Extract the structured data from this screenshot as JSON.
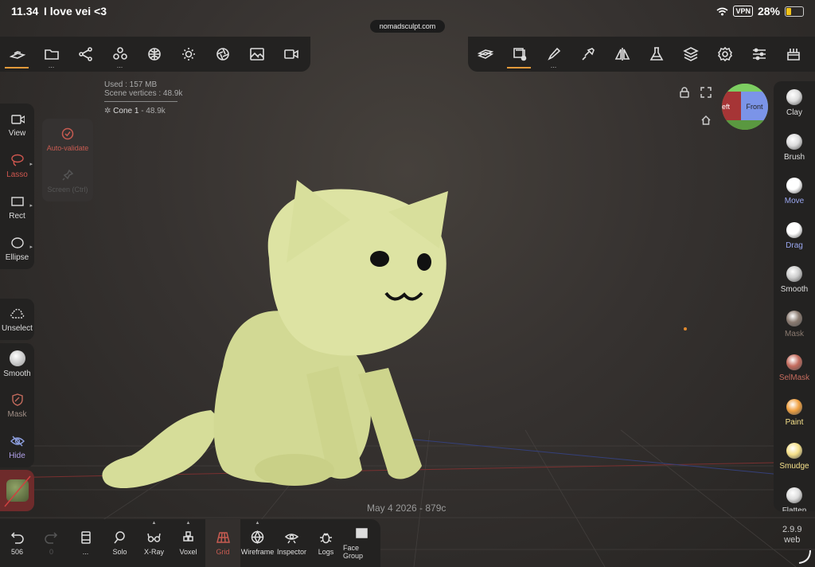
{
  "status_bar": {
    "time": "11.34",
    "message": "I love vei <3",
    "vpn": "VPN",
    "battery": "28%",
    "url": "nomadsculpt.com"
  },
  "top_toolbar_left": [
    {
      "icon": "scene-icon",
      "active": true
    },
    {
      "icon": "folder-icon",
      "dots": "..."
    },
    {
      "icon": "share-nodes-icon"
    },
    {
      "icon": "primitives-icon",
      "dots": "..."
    },
    {
      "icon": "material-sphere-icon"
    },
    {
      "icon": "light-icon"
    },
    {
      "icon": "aperture-icon"
    },
    {
      "icon": "image-icon"
    },
    {
      "icon": "camera-icon"
    }
  ],
  "top_toolbar_right": [
    {
      "icon": "mesh-icon"
    },
    {
      "icon": "selection-icon",
      "active": true
    },
    {
      "icon": "brush-icon",
      "dots": "..."
    },
    {
      "icon": "stroke-icon"
    },
    {
      "icon": "symmetry-icon"
    },
    {
      "icon": "flask-icon"
    },
    {
      "icon": "layers-icon"
    },
    {
      "icon": "settings-icon"
    },
    {
      "icon": "sliders-icon"
    },
    {
      "icon": "interface-icon"
    }
  ],
  "scene_info": {
    "used": "Used : 157 MB",
    "vertices": "Scene vertices : 48.9k",
    "object_name": "Cone 1",
    "object_vertices": "- 48.9k"
  },
  "gizmo": {
    "left": "eft",
    "front": "Front"
  },
  "left_tools": [
    {
      "label": "View",
      "icon": "camera-icon"
    },
    {
      "label": "Lasso",
      "icon": "lasso-icon",
      "selected": true
    },
    {
      "label": "Rect",
      "icon": "rect-icon"
    },
    {
      "label": "Ellipse",
      "icon": "ellipse-icon"
    }
  ],
  "lasso_submenu": {
    "auto_validate": "Auto-validate",
    "screen": "Screen (Ctrl)"
  },
  "left_extra": {
    "unselect": "Unselect",
    "smooth": "Smooth",
    "mask": "Mask",
    "hide": "Hide"
  },
  "right_tools": [
    {
      "label": "Clay",
      "color": "#dddddd",
      "label_color": "#dddddd"
    },
    {
      "label": "Brush",
      "color": "#dddddd",
      "label_color": "#dddddd"
    },
    {
      "label": "Move",
      "color": "#ffffff",
      "label_color": "#9aa7f0"
    },
    {
      "label": "Drag",
      "color": "#ffffff",
      "label_color": "#9aa7f0"
    },
    {
      "label": "Smooth",
      "color": "#cccccc",
      "label_color": "#dddddd"
    },
    {
      "label": "Mask",
      "color": "#8a7a70",
      "label_color": "#8a7a70"
    },
    {
      "label": "SelMask",
      "color": "#c46b5d",
      "label_color": "#c46b5d"
    },
    {
      "label": "Paint",
      "color": "#f0a040",
      "label_color": "#f5e08a"
    },
    {
      "label": "Smudge",
      "color": "#f5e08a",
      "label_color": "#f5e08a"
    },
    {
      "label": "Flatten",
      "color": "#dddddd",
      "label_color": "#dddddd"
    }
  ],
  "bottom_tools": [
    {
      "label": "506",
      "icon": "undo-icon"
    },
    {
      "label": "0",
      "icon": "redo-icon",
      "dim": true
    },
    {
      "label": "...",
      "icon": "book-icon"
    },
    {
      "label": "Solo",
      "icon": "magnifier-icon"
    },
    {
      "label": "X-Ray",
      "icon": "glasses-icon",
      "caret": true
    },
    {
      "label": "Voxel",
      "icon": "voxel-icon",
      "caret": true
    },
    {
      "label": "Grid",
      "icon": "grid-icon",
      "selected": true
    },
    {
      "label": "Wireframe",
      "icon": "wireframe-icon",
      "caret": true
    },
    {
      "label": "Inspector",
      "icon": "eye-icon"
    },
    {
      "label": "Logs",
      "icon": "bug-icon"
    },
    {
      "label": "Face Group",
      "icon": "facegroup-icon"
    }
  ],
  "viewport": {
    "datestamp": "May 4 2026 - 879c",
    "version_number": "2.9.9",
    "version_label": "web"
  }
}
